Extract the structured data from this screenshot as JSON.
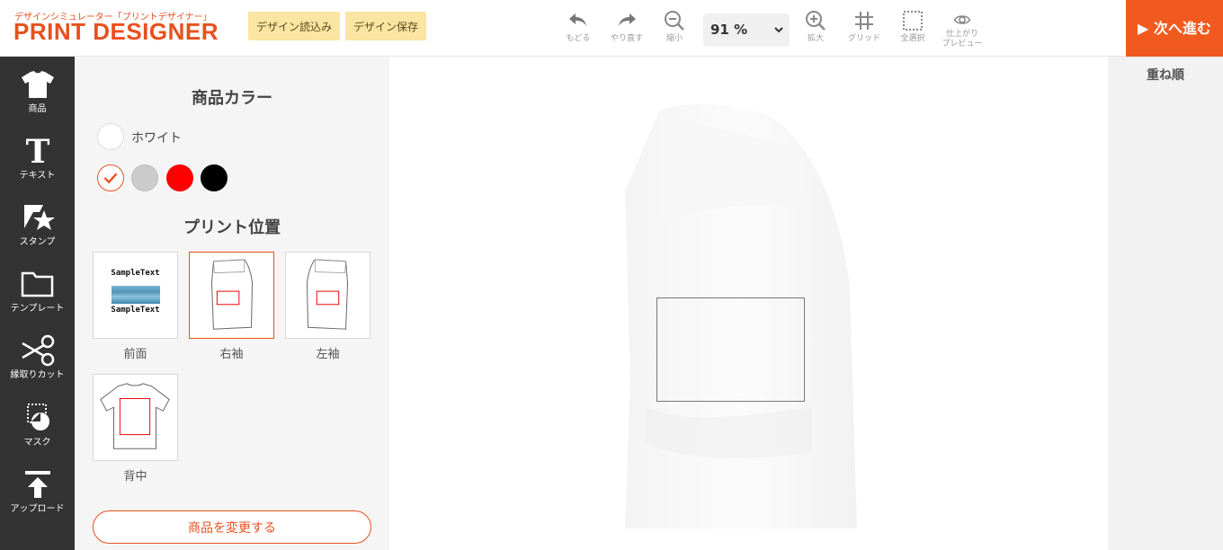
{
  "header": {
    "logo_sub": "デザインシミュレーター「プリントデザイナー」",
    "logo_main": "PRINT DESIGNER",
    "load_label": "デザイン読込み",
    "save_label": "デザイン保存",
    "tools": [
      {
        "label": "もどる",
        "icon": "undo-icon"
      },
      {
        "label": "やり直す",
        "icon": "redo-icon"
      },
      {
        "label": "縮小",
        "icon": "zoom-out-icon"
      },
      {
        "label": "拡大",
        "icon": "zoom-in-icon"
      },
      {
        "label": "グリッド",
        "icon": "grid-icon"
      },
      {
        "label": "全選択",
        "icon": "select-all-icon"
      },
      {
        "label_line1": "仕上がり",
        "label_line2": "プレビュー",
        "icon": "eye-icon"
      }
    ],
    "zoom_value": "91 %",
    "next_label": "▶ 次へ進む"
  },
  "sidebar": {
    "items": [
      {
        "label": "商品",
        "icon": "tshirt-icon"
      },
      {
        "label": "テキスト",
        "icon": "text-icon"
      },
      {
        "label": "スタンプ",
        "icon": "stamp-icon"
      },
      {
        "label": "テンプレート",
        "icon": "folder-icon"
      },
      {
        "label": "縁取りカット",
        "icon": "scissors-icon"
      },
      {
        "label": "マスク",
        "icon": "mask-icon"
      },
      {
        "label": "アップロード",
        "icon": "upload-icon"
      }
    ]
  },
  "panel": {
    "color_title": "商品カラー",
    "selected_color_name": "ホワイト",
    "colors": [
      {
        "name": "white",
        "hex": "#ffffff",
        "selected": true
      },
      {
        "name": "gray",
        "hex": "#cccccc"
      },
      {
        "name": "red",
        "hex": "#ff0000"
      },
      {
        "name": "black",
        "hex": "#000000"
      }
    ],
    "position_title": "プリント位置",
    "positions": [
      {
        "label": "前面",
        "sample_text_top": "SampleText",
        "sample_text_bottom": "SampleText"
      },
      {
        "label": "右袖",
        "selected": true
      },
      {
        "label": "左袖"
      },
      {
        "label": "背中"
      }
    ],
    "change_label": "商品を変更する"
  },
  "right_panel": {
    "title": "重ね順"
  },
  "colors": {
    "accent": "#e8501e",
    "header_button_bg": "#fbe5a2",
    "iconbar_bg": "#333333"
  }
}
